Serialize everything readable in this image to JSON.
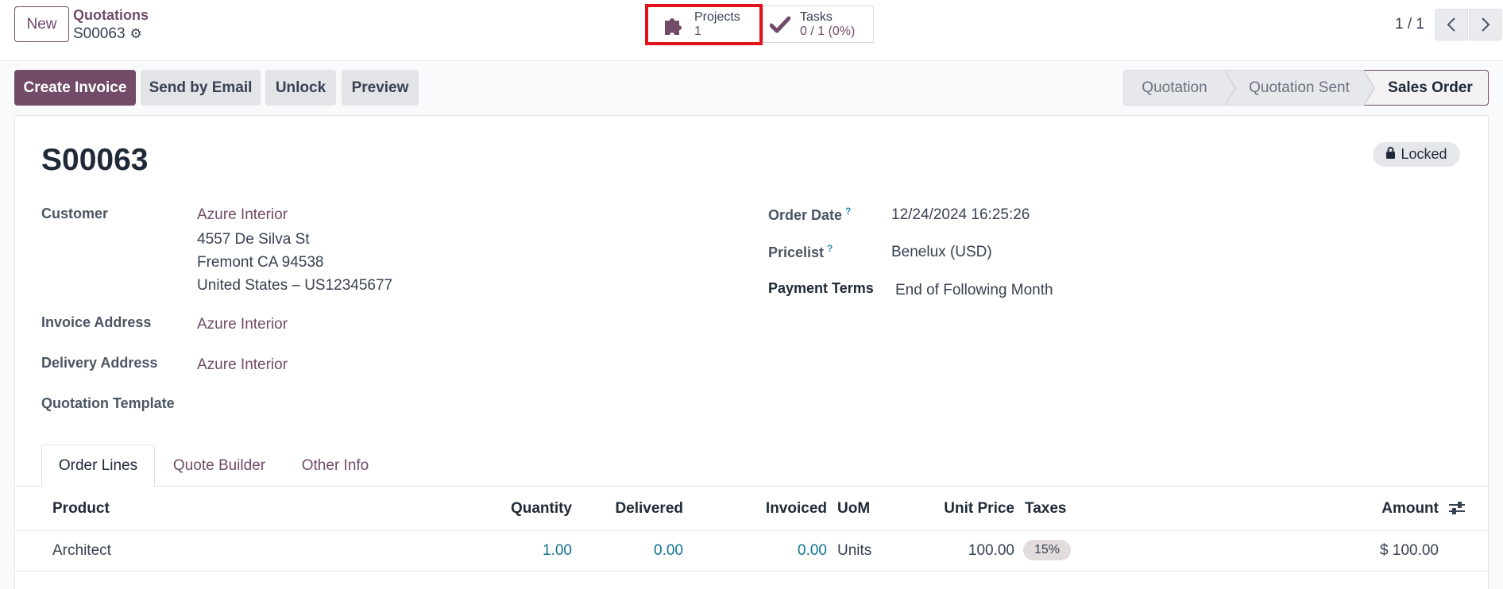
{
  "header": {
    "new_label": "New",
    "breadcrumb_parent": "Quotations",
    "breadcrumb_current": "S00063",
    "pager": "1 / 1"
  },
  "smart_buttons": {
    "projects": {
      "label": "Projects",
      "value": "1",
      "icon": "puzzle-icon"
    },
    "tasks": {
      "label": "Tasks",
      "value": "0 / 1 (0%)",
      "icon": "check-icon"
    }
  },
  "actions": {
    "create_invoice": "Create Invoice",
    "send_by_email": "Send by Email",
    "unlock": "Unlock",
    "preview": "Preview"
  },
  "status": {
    "steps": [
      "Quotation",
      "Quotation Sent",
      "Sales Order"
    ],
    "current": "Sales Order"
  },
  "form": {
    "name": "S00063",
    "locked_label": "Locked",
    "customer_label": "Customer",
    "customer_name": "Azure Interior",
    "customer_address": [
      "4557 De Silva St",
      "Fremont CA 94538",
      "United States – US12345677"
    ],
    "invoice_address_label": "Invoice Address",
    "invoice_address": "Azure Interior",
    "delivery_address_label": "Delivery Address",
    "delivery_address": "Azure Interior",
    "quotation_template_label": "Quotation Template",
    "order_date_label": "Order Date",
    "order_date": "12/24/2024 16:25:26",
    "pricelist_label": "Pricelist",
    "pricelist": "Benelux (USD)",
    "payment_terms_label": "Payment Terms",
    "payment_terms": "End of Following Month",
    "help_mark": "?"
  },
  "tabs": [
    "Order Lines",
    "Quote Builder",
    "Other Info"
  ],
  "table": {
    "headers": {
      "product": "Product",
      "quantity": "Quantity",
      "delivered": "Delivered",
      "invoiced": "Invoiced",
      "uom": "UoM",
      "unit_price": "Unit Price",
      "taxes": "Taxes",
      "amount": "Amount"
    },
    "rows": [
      {
        "product": "Architect",
        "quantity": "1.00",
        "delivered": "0.00",
        "invoiced": "0.00",
        "uom": "Units",
        "unit_price": "100.00",
        "taxes": "15%",
        "amount": "$ 100.00"
      }
    ]
  },
  "colors": {
    "brand": "#714b67",
    "highlight": "#e0131b",
    "link_numeric": "#0f7490"
  }
}
